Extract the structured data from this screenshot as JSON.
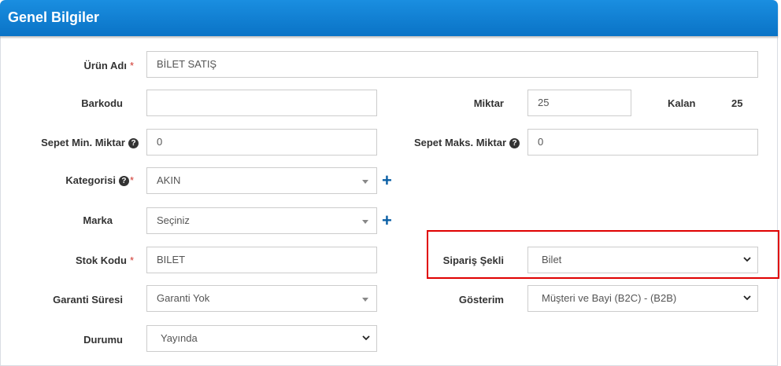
{
  "header": {
    "title": "Genel Bilgiler"
  },
  "form": {
    "urun_adi": {
      "label": "Ürün Adı",
      "value": "BİLET SATIŞ",
      "required_mark": "*"
    },
    "barkodu": {
      "label": "Barkodu",
      "value": ""
    },
    "miktar": {
      "label": "Miktar",
      "value": "25"
    },
    "kalan": {
      "label": "Kalan",
      "value": "25"
    },
    "sepet_min": {
      "label": "Sepet Min. Miktar",
      "value": "0",
      "help": "?"
    },
    "sepet_maks": {
      "label": "Sepet Maks. Miktar",
      "value": "0",
      "help": "?"
    },
    "kategorisi": {
      "label": "Kategorisi",
      "value": "AKIN",
      "help": "?",
      "required_mark": "*",
      "add": "+"
    },
    "marka": {
      "label": "Marka",
      "value": "Seçiniz",
      "add": "+"
    },
    "stok_kodu": {
      "label": "Stok Kodu",
      "value": "BILET",
      "required_mark": "*"
    },
    "siparis_sekli": {
      "label": "Sipariş Şekli",
      "value": "Bilet"
    },
    "garanti_suresi": {
      "label": "Garanti Süresi",
      "value": "Garanti Yok"
    },
    "gosterim": {
      "label": "Gösterim",
      "value": "Müşteri ve Bayi (B2C) - (B2B)"
    },
    "durumu": {
      "label": "Durumu",
      "value": "Yayında"
    }
  },
  "colors": {
    "header": "#0a73c6",
    "highlight": "#e00000",
    "required": "#d0342c",
    "add_icon": "#0b5fa5"
  }
}
